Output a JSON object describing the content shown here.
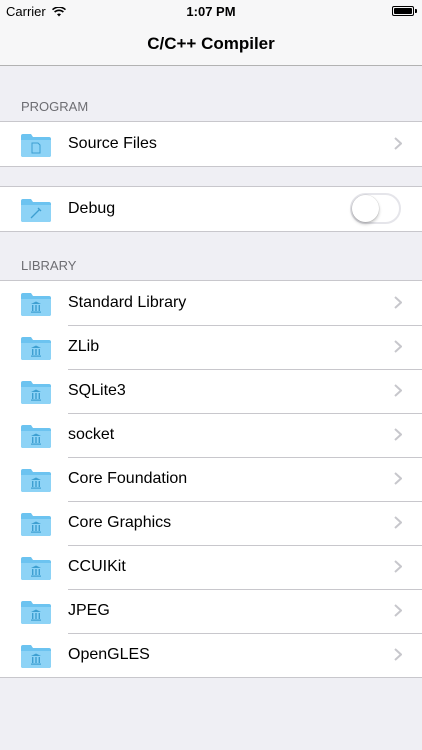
{
  "status_bar": {
    "carrier": "Carrier",
    "time": "1:07 PM"
  },
  "nav": {
    "title": "C/C++ Compiler"
  },
  "program": {
    "header": "PROGRAM",
    "source_files_label": "Source Files",
    "debug_label": "Debug",
    "debug_enabled": false
  },
  "library": {
    "header": "LIBRARY",
    "items": [
      {
        "label": "Standard Library"
      },
      {
        "label": "ZLib"
      },
      {
        "label": "SQLite3"
      },
      {
        "label": "socket"
      },
      {
        "label": "Core Foundation"
      },
      {
        "label": "Core Graphics"
      },
      {
        "label": "CCUIKit"
      },
      {
        "label": "JPEG"
      },
      {
        "label": "OpenGLES"
      }
    ]
  },
  "colors": {
    "folder": "#6cc3f0",
    "chevron": "#c7c7cc",
    "background": "#efeff4"
  }
}
